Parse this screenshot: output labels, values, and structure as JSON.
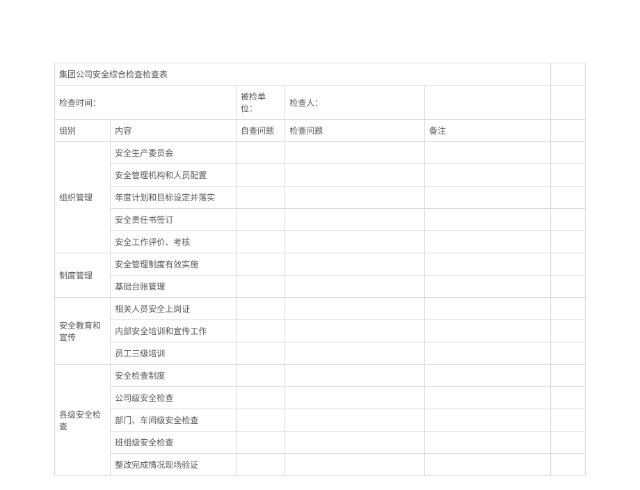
{
  "title": "集团公司安全综合检查检查表",
  "meta": {
    "check_time_label": "检查时间：",
    "checked_unit_label": "被检单位：",
    "checker_label": "检查人："
  },
  "headers": {
    "group": "组别",
    "content": "内容",
    "self_issue": "自查问题",
    "check_issue": "检查问题",
    "note": "备注"
  },
  "sections": [
    {
      "group": "组织管理",
      "items": [
        "安全生产委员会",
        "安全管理机构和人员配置",
        "年度计划和目标设定并落实",
        "安全责任书签订",
        "安全工作评价、考核"
      ]
    },
    {
      "group": "制度管理",
      "items": [
        "安全管理制度有效实施",
        "基础台账管理"
      ]
    },
    {
      "group": "安全教育和宣传",
      "items": [
        "相关人员安全上岗证",
        "内部安全培训和宣传工作",
        "员工三级培训"
      ]
    },
    {
      "group": "各级安全检查",
      "items": [
        "安全检查制度",
        "公司级安全检查",
        "部门、车间级安全检查",
        "班组级安全检查",
        "整改完成情况现场验证"
      ]
    }
  ]
}
